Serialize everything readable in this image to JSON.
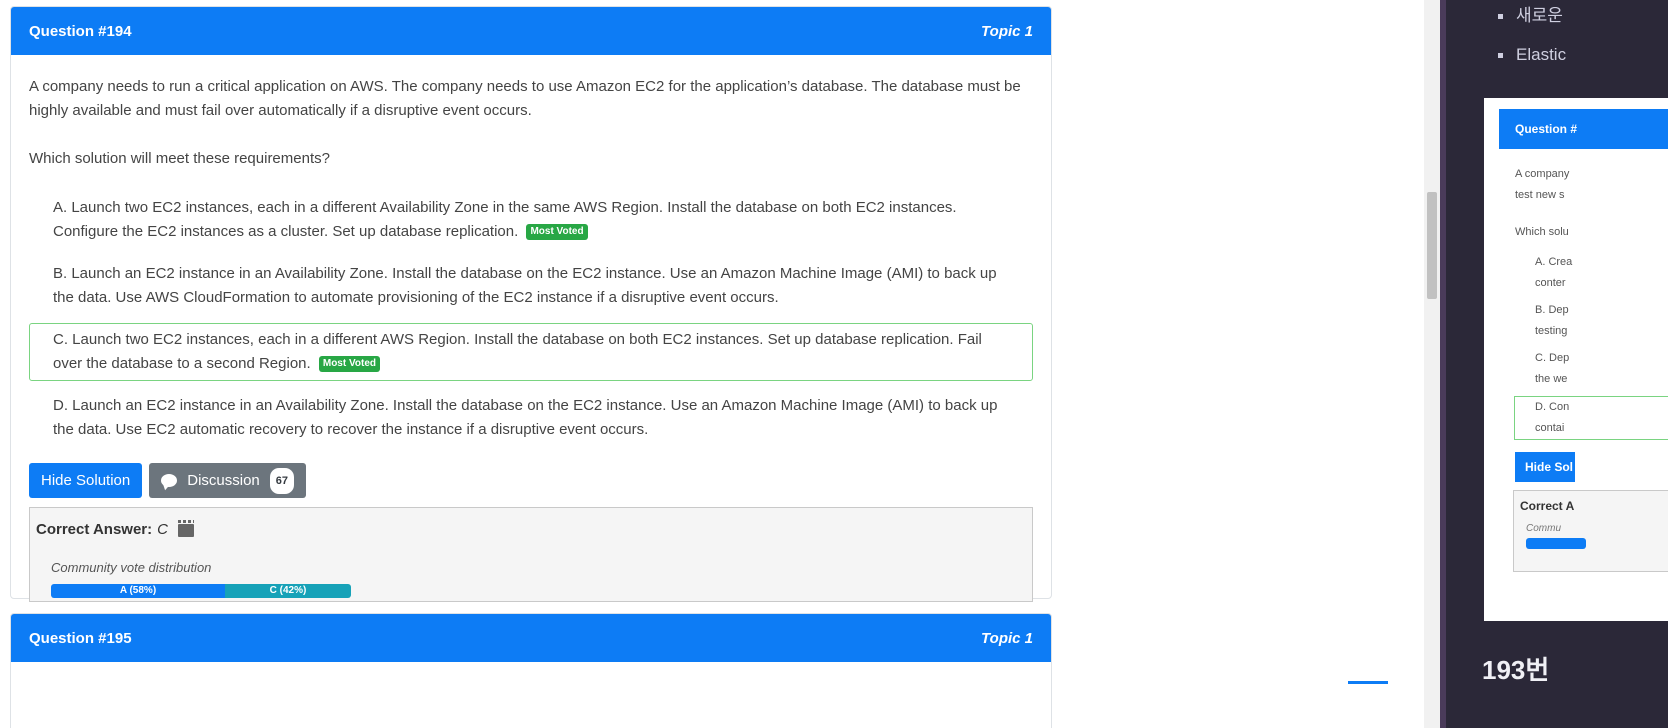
{
  "question1": {
    "title": "Question #194",
    "topic": "Topic 1",
    "text": "A company needs to run a critical application on AWS. The company needs to use Amazon EC2 for the application’s database. The database must be highly available and must fail over automatically if a disruptive event occurs.",
    "ask": "Which solution will meet these requirements?",
    "choices": [
      {
        "text": "A. Launch two EC2 instances, each in a different Availability Zone in the same AWS Region. Install the database on both EC2 instances. Configure the EC2 instances as a cluster. Set up database replication.",
        "badge": "Most Voted"
      },
      {
        "text": "B. Launch an EC2 instance in an Availability Zone. Install the database on the EC2 instance. Use an Amazon Machine Image (AMI) to back up the data. Use AWS CloudFormation to automate provisioning of the EC2 instance if a disruptive event occurs."
      },
      {
        "text": "C. Launch two EC2 instances, each in a different AWS Region. Install the database on both EC2 instances. Set up database replication. Fail over the database to a second Region.",
        "badge": "Most Voted"
      },
      {
        "text": "D. Launch an EC2 instance in an Availability Zone. Install the database on the EC2 instance. Use an Amazon Machine Image (AMI) to back up the data. Use EC2 automatic recovery to recover the instance if a disruptive event occurs."
      }
    ],
    "hide_solution_label": "Hide Solution",
    "discussion_label": "Discussion",
    "discussion_count": "67",
    "correct_answer_label": "Correct Answer:",
    "correct_answer_value": "C",
    "vote_label": "Community vote distribution",
    "votes": [
      {
        "label": "A (58%)",
        "percent": 58
      },
      {
        "label": "C (42%)",
        "percent": 42
      }
    ]
  },
  "question2": {
    "title": "Question #195",
    "topic": "Topic 1"
  },
  "right_panel": {
    "list": [
      "새로운",
      "Elastic"
    ],
    "mini": {
      "header": "Question #",
      "text_lines": [
        "A company",
        "test new s"
      ],
      "ask": "Which solu",
      "choices": [
        {
          "lines": [
            "A. Crea",
            "conter"
          ]
        },
        {
          "lines": [
            "B. Dep",
            "testing"
          ]
        },
        {
          "lines": [
            "C. Dep",
            "the we"
          ]
        },
        {
          "lines": [
            "D. Con",
            "contai"
          ]
        }
      ],
      "button": "Hide Sol",
      "answer_label": "Correct A",
      "community": "Commu"
    },
    "number": "193번"
  },
  "colors": {
    "header_blue": "#0d7cf5",
    "most_voted_green": "#28a745",
    "vote_teal": "#17a2b8",
    "panel_dark": "#2b2838"
  }
}
